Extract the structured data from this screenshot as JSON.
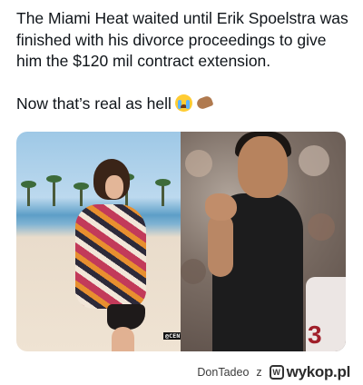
{
  "post": {
    "line1": "The Miami Heat waited until Erik Spoelstra was finished with his divorce proceedings to give him the $120 mil contract extension.",
    "line2": "Now that’s real as hell",
    "emojis": [
      "loudly-crying-face",
      "flexed-biceps"
    ]
  },
  "media": {
    "watermark": "@CENTRNBAMEMES",
    "jersey_number": "3"
  },
  "footer": {
    "author": "DonTadeo",
    "connector": "z",
    "site": "wykop.pl",
    "site_mark": "W"
  },
  "colors": {
    "text": "#0f1419",
    "background": "#ffffff",
    "footer_text": "#3b3b3b"
  }
}
